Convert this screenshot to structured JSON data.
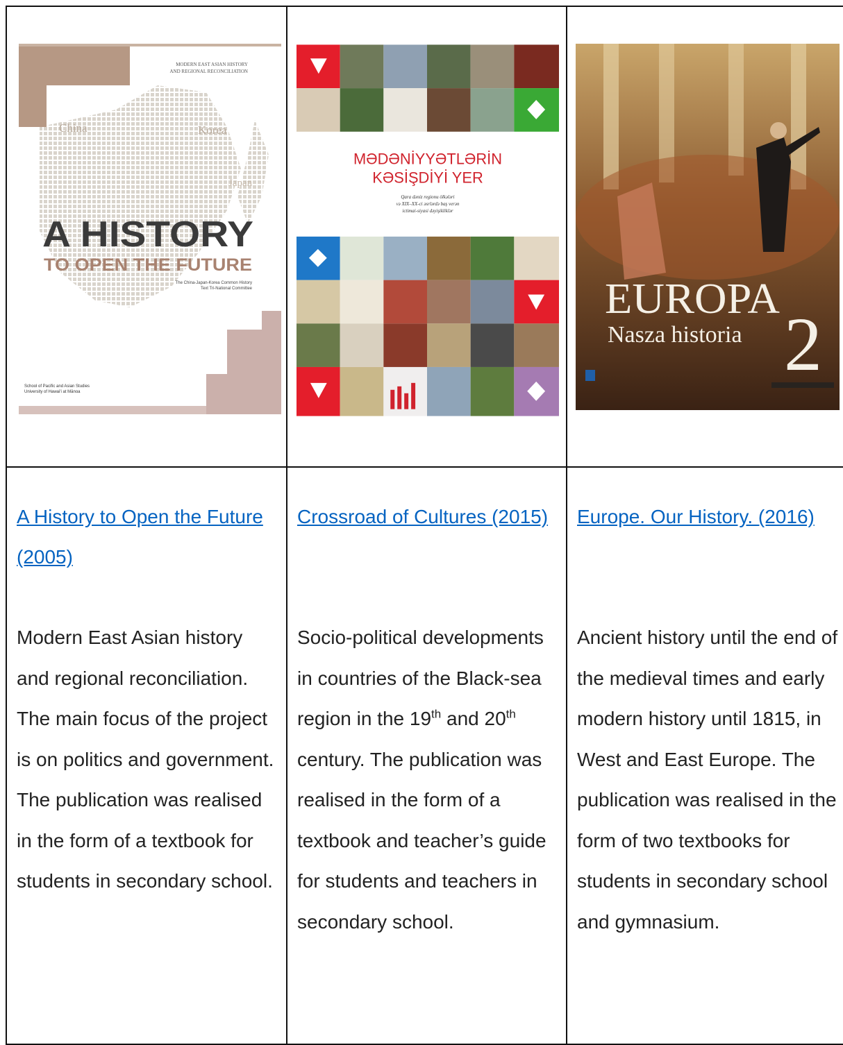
{
  "books": [
    {
      "cover": {
        "header_line1": "MODERN EAST ASIAN HISTORY",
        "header_line2": "AND REGIONAL RECONCILIATION",
        "map_label_china": "China",
        "map_label_korea": "Korea",
        "map_label_japan": "Japan",
        "title_main": "A HISTORY",
        "title_sub": "TO OPEN THE FUTURE",
        "tag_line1": "The China-Japan-Korea Common History",
        "tag_line2": "Text Tri-National Committee",
        "publisher_line1": "School of Pacific and Asian Studies",
        "publisher_line2": "University of Hawai'i at Mānoa"
      },
      "link_text": "A History to Open the Future (2005)",
      "description": "Modern East Asian history and regional reconciliation. The main focus of the project is on politics and government. The publication was realised in the form of a textbook for students in secondary school."
    },
    {
      "cover": {
        "title_line1": "MƏDƏNİYYƏTLƏRİN",
        "title_line2": "KƏSİŞDİYİ YER",
        "subtitle_line1": "Qara dəniz regionu ölkələri",
        "subtitle_line2": "və XIX–XX-ci əsrlərdə baş verən",
        "subtitle_line3": "ictimai-siyasi dəyişikliklər",
        "accent_red": "#e41e2b",
        "accent_green": "#3aa935",
        "accent_blue": "#1f78c8",
        "accent_purple": "#a57bb2"
      },
      "link_text": "Crossroad of Cultures (2015)",
      "description_part1": "Socio-political developments in countries of the Black-sea region in the 19",
      "sup1": "th",
      "description_part2": " and 20",
      "sup2": "th",
      "description_part3": " century. The publication was realised in the form of a textbook and teacher’s guide for students and teachers in secondary school."
    },
    {
      "cover": {
        "title_main": "EUROPA",
        "title_sub": "Nasza historia",
        "volume": "2"
      },
      "link_text": "Europe. Our History. (2016)",
      "description": "Ancient history until the end of the medieval times and early modern history until 1815, in West and East Europe. The publication was realised in the form of two textbooks for students in secondary school and gymnasium."
    }
  ],
  "colors": {
    "link": "#0563c1",
    "text": "#222222",
    "border": "#111111"
  }
}
